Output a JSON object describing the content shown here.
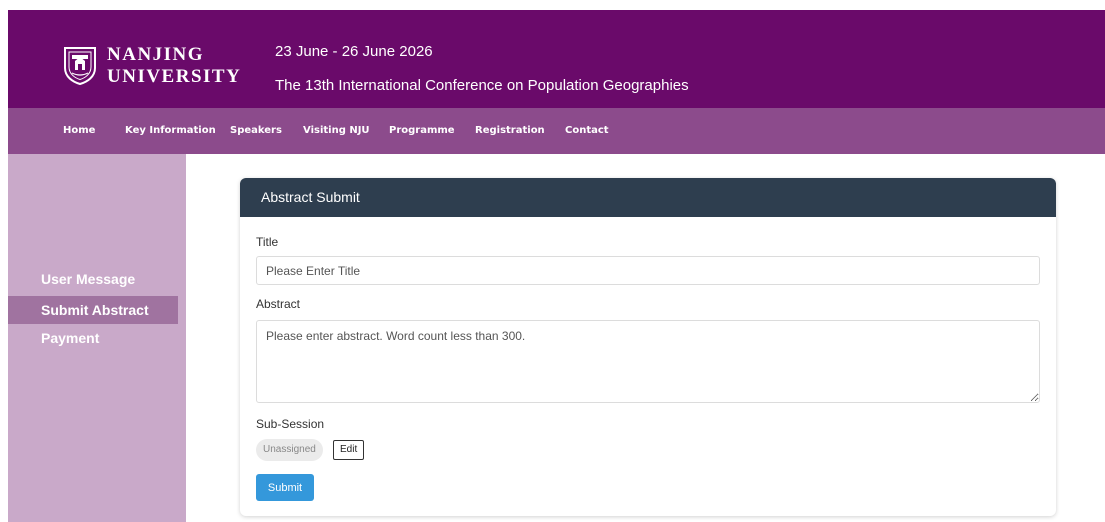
{
  "brand": {
    "line1": "NANJING",
    "line2": "UNIVERSITY",
    "colors": {
      "header": "#6a0a6a",
      "nav": "#8c4b8c",
      "sidebar": "#c9a9c9",
      "sidebar_active": "#a073a0"
    }
  },
  "conference": {
    "dates": "23 June - 26 June 2026",
    "title": "The 13th International Conference on Population Geographies"
  },
  "nav": {
    "items": [
      {
        "label": "Home"
      },
      {
        "label": "Key Information"
      },
      {
        "label": "Speakers"
      },
      {
        "label": "Visiting NJU"
      },
      {
        "label": "Programme"
      },
      {
        "label": "Registration"
      },
      {
        "label": "Contact"
      }
    ]
  },
  "sidebar": {
    "items": [
      {
        "label": "User Message",
        "active": false
      },
      {
        "label": "Submit Abstract",
        "active": true
      },
      {
        "label": "Payment",
        "active": false
      }
    ]
  },
  "form": {
    "header": "Abstract Submit",
    "title_label": "Title",
    "title_placeholder": "Please Enter Title",
    "abstract_label": "Abstract",
    "abstract_placeholder": "Please enter abstract. Word count less than 300.",
    "subsession_label": "Sub-Session",
    "subsession_value": "Unassigned",
    "edit_label": "Edit",
    "submit_label": "Submit",
    "colors": {
      "card_header": "#2e3e4f",
      "submit": "#3498db"
    }
  }
}
